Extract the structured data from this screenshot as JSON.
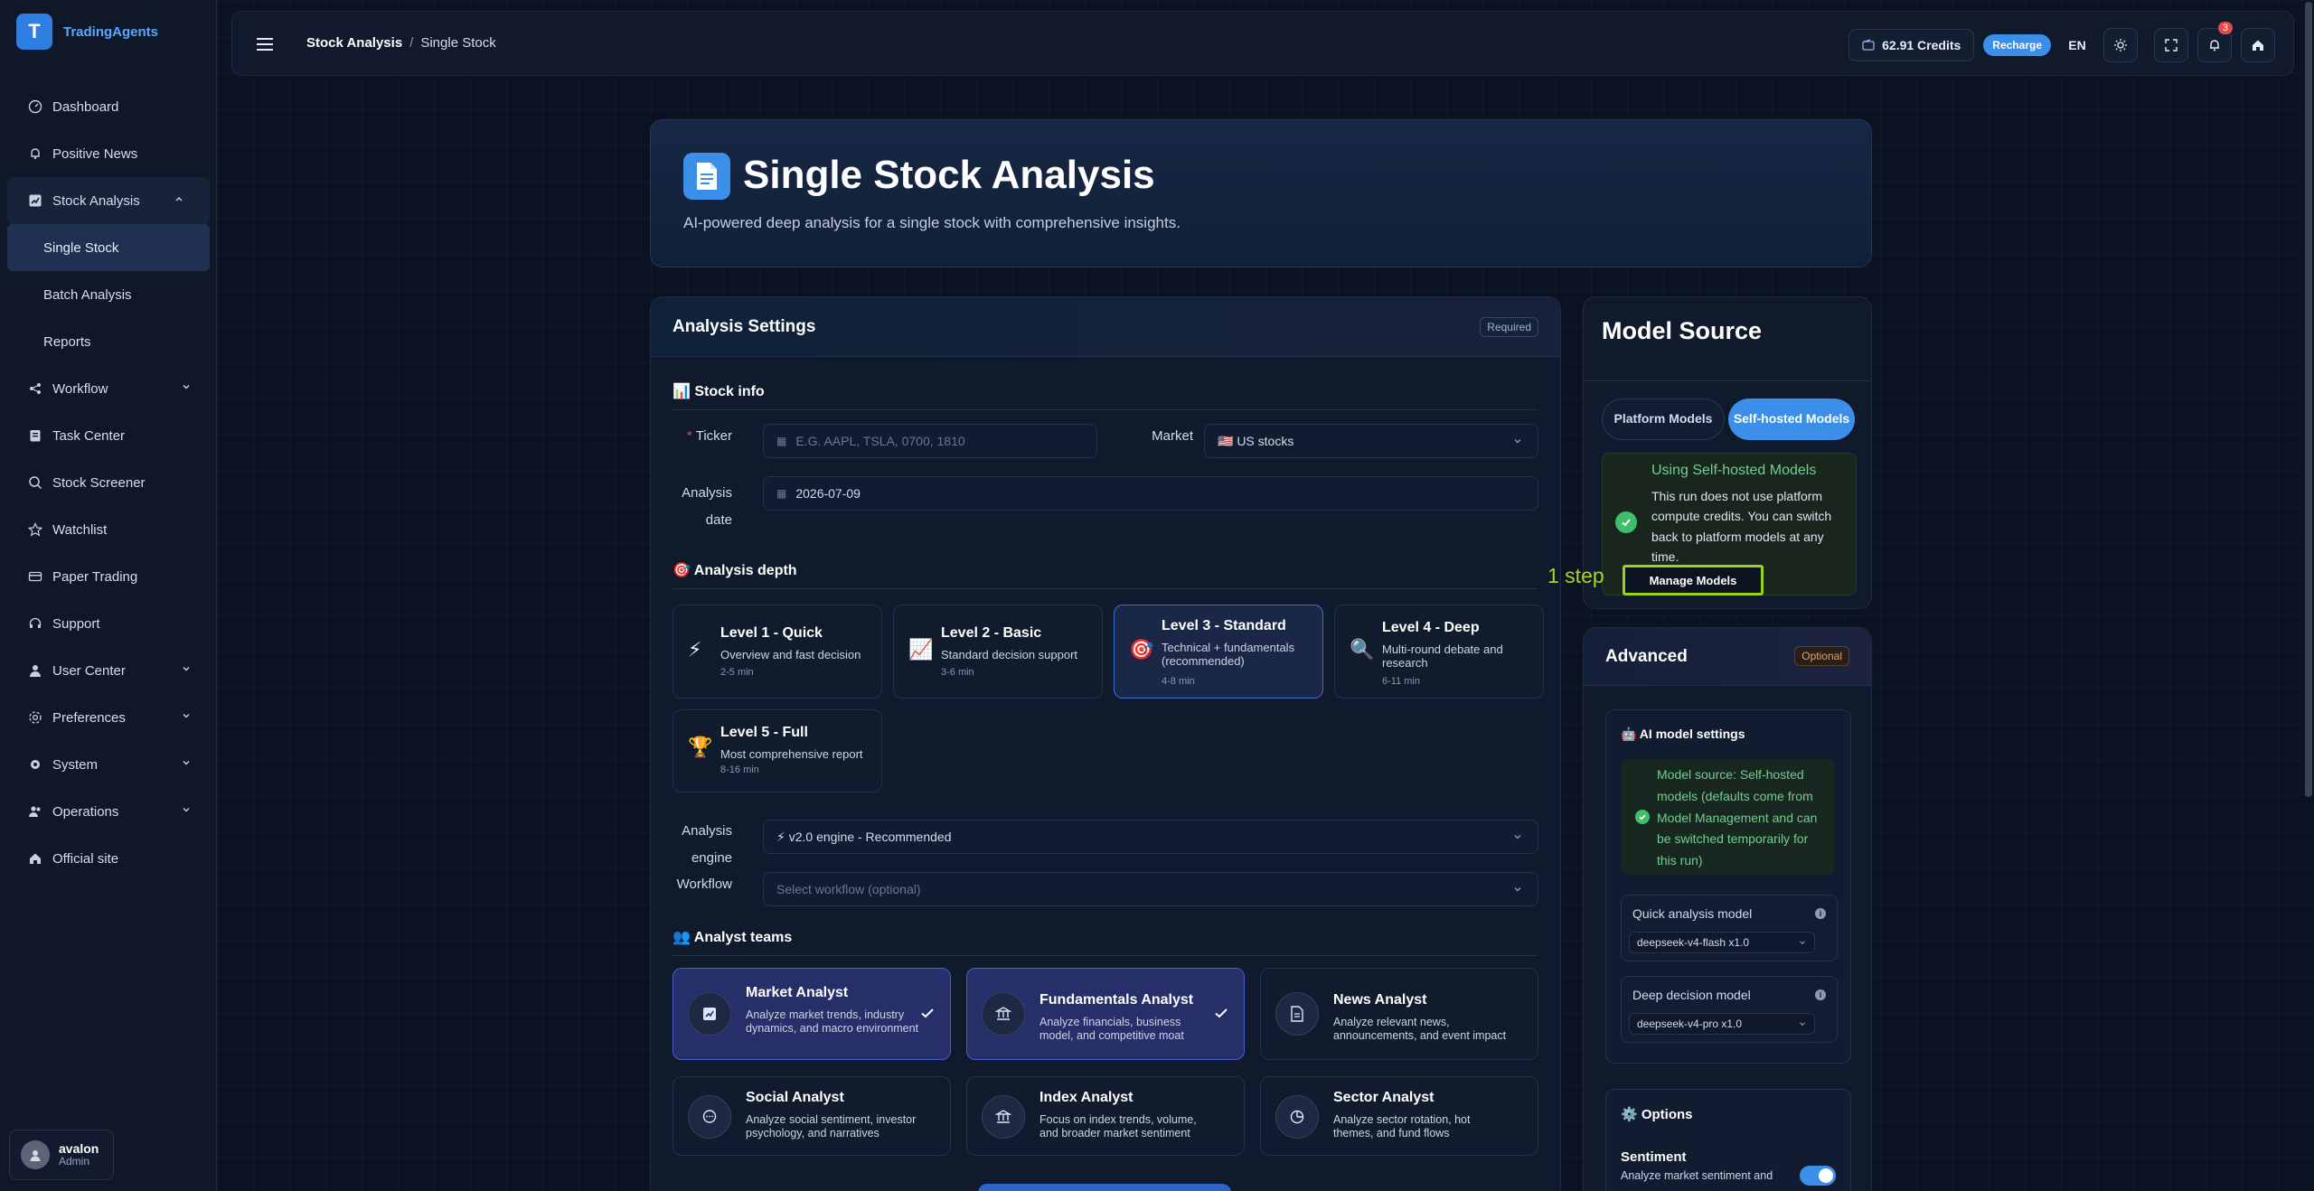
{
  "brand": {
    "logo_letter": "T",
    "name": "TradingAgents"
  },
  "sidebar": {
    "items": [
      {
        "label": "Dashboard",
        "icon": "dashboard-icon"
      },
      {
        "label": "Positive News",
        "icon": "bell-icon"
      },
      {
        "label": "Stock Analysis",
        "icon": "chart-icon",
        "expanded": true
      },
      {
        "label": "Single Stock",
        "sub": true,
        "active": true
      },
      {
        "label": "Batch Analysis",
        "sub": true
      },
      {
        "label": "Reports",
        "sub": true
      },
      {
        "label": "Workflow",
        "icon": "share-icon"
      },
      {
        "label": "Task Center",
        "icon": "clipboard-icon"
      },
      {
        "label": "Stock Screener",
        "icon": "search-icon"
      },
      {
        "label": "Watchlist",
        "icon": "star-icon"
      },
      {
        "label": "Paper Trading",
        "icon": "card-icon"
      },
      {
        "label": "Support",
        "icon": "headset-icon"
      },
      {
        "label": "User Center",
        "icon": "user-icon"
      },
      {
        "label": "Preferences",
        "icon": "settings-icon"
      },
      {
        "label": "System",
        "icon": "gear-icon"
      },
      {
        "label": "Operations",
        "icon": "users-icon"
      },
      {
        "label": "Official site",
        "icon": "home-icon"
      }
    ],
    "user": {
      "name": "avalon",
      "role": "Admin"
    }
  },
  "topbar": {
    "breadcrumb": {
      "parent": "Stock Analysis",
      "separator": "/",
      "current": "Single Stock"
    },
    "credits": "62.91 Credits",
    "recharge": "Recharge",
    "language": "EN",
    "notification_count": "3"
  },
  "hero": {
    "title": "Single Stock Analysis",
    "subtitle": "AI-powered deep analysis for a single stock with comprehensive insights."
  },
  "settings": {
    "title": "Analysis Settings",
    "required_badge": "Required",
    "stock_info_title": "📊 Stock info",
    "ticker_label": "Ticker",
    "ticker_placeholder": "E.G. AAPL, TSLA, 0700, 1810",
    "market_label": "Market",
    "market_value": "🇺🇸 US stocks",
    "date_label_1": "Analysis",
    "date_label_2": "date",
    "date_value": "2026-07-09",
    "depth_title": "🎯 Analysis depth",
    "levels": [
      {
        "icon": "⚡",
        "name": "Level 1 - Quick",
        "desc": "Overview and fast decision",
        "time": "2-5 min"
      },
      {
        "icon": "📈",
        "name": "Level 2 - Basic",
        "desc": "Standard decision support",
        "time": "3-6 min"
      },
      {
        "icon": "🎯",
        "name": "Level 3 - Standard",
        "desc": "Technical + fundamentals (recommended)",
        "time": "4-8 min",
        "selected": true
      },
      {
        "icon": "🔍",
        "name": "Level 4 - Deep",
        "desc": "Multi-round debate and research",
        "time": "6-11 min"
      },
      {
        "icon": "🏆",
        "name": "Level 5 - Full",
        "desc": "Most comprehensive report",
        "time": "8-16 min"
      }
    ],
    "engine_label_1": "Analysis",
    "engine_label_2": "engine",
    "engine_value": "⚡ v2.0 engine - Recommended",
    "workflow_label": "Workflow",
    "workflow_placeholder": "Select workflow (optional)",
    "teams_title": "👥 Analyst teams",
    "analysts": [
      {
        "name": "Market Analyst",
        "desc": "Analyze market trends, industry dynamics, and macro environment",
        "icon": "chart-icon",
        "selected": true
      },
      {
        "name": "Fundamentals Analyst",
        "desc": "Analyze financials, business model, and competitive moat",
        "icon": "bank-icon",
        "selected": true
      },
      {
        "name": "News Analyst",
        "desc": "Analyze relevant news, announcements, and event impact",
        "icon": "document-icon",
        "selected": false
      },
      {
        "name": "Social Analyst",
        "desc": "Analyze social sentiment, investor psychology, and narratives",
        "icon": "chat-icon",
        "selected": false
      },
      {
        "name": "Index Analyst",
        "desc": "Focus on index trends, volume, and broader market sentiment",
        "icon": "building-icon",
        "selected": false
      },
      {
        "name": "Sector Analyst",
        "desc": "Analyze sector rotation, hot themes, and fund flows",
        "icon": "pie-icon",
        "selected": false
      }
    ]
  },
  "model_source": {
    "title": "Model Source",
    "tab_platform": "Platform Models",
    "tab_self": "Self-hosted Models",
    "notice_title": "Using Self-hosted Models",
    "notice_text": "This run does not use platform compute credits. You can switch back to platform models at any time.",
    "manage_button": "Manage Models",
    "step_label": "1 step"
  },
  "advanced": {
    "title": "Advanced",
    "optional_badge": "Optional",
    "ai_title": "🤖 AI model settings",
    "ai_note": "Model source: Self-hosted models (defaults come from Model Management and can be switched temporarily for this run)",
    "quick_label": "Quick analysis model",
    "quick_value": "deepseek-v4-flash x1.0",
    "deep_label": "Deep decision model",
    "deep_value": "deepseek-v4-pro x1.0",
    "options_title": "⚙️ Options",
    "sentiment_label": "Sentiment",
    "sentiment_desc": "Analyze market sentiment and",
    "sentiment_on": true
  },
  "colors": {
    "accent": "#3b8fe8",
    "highlight": "#9bd21a",
    "success": "#3fbf6c"
  }
}
